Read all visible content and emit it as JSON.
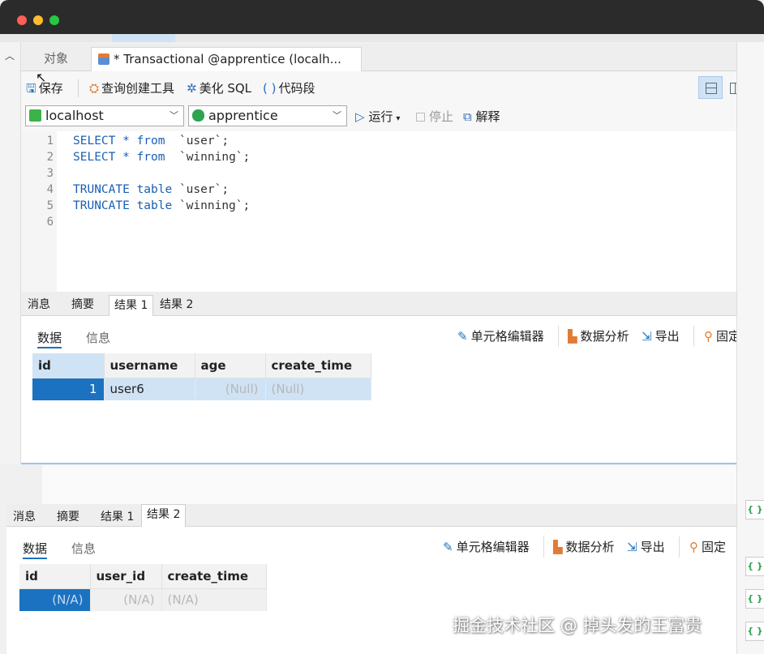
{
  "window": {
    "title_tab_selected": ""
  },
  "tabs": {
    "objects": "对象",
    "query": "* Transactional @apprentice (localh..."
  },
  "toolbar": {
    "save": "保存",
    "query_builder": "查询创建工具",
    "beautify": "美化 SQL",
    "snippet": "代码段"
  },
  "connection": {
    "host": "localhost",
    "database": "apprentice"
  },
  "run": {
    "run": "运行",
    "stop": "停止",
    "explain": "解释"
  },
  "editor": {
    "line_numbers": [
      "1",
      "2",
      "3",
      "4",
      "5",
      "6"
    ],
    "lines": [
      {
        "kw": "SELECT * from",
        "rest": "  `user`;"
      },
      {
        "kw": "SELECT * from",
        "rest": "  `winning`;"
      },
      {
        "kw": "",
        "rest": ""
      },
      {
        "kw": "TRUNCATE table",
        "rest": " `user`;"
      },
      {
        "kw": "TRUNCATE table",
        "rest": " `winning`;"
      },
      {
        "kw": "",
        "rest": ""
      }
    ]
  },
  "result_tabs": [
    "消息",
    "摘要",
    "结果 1",
    "结果 2"
  ],
  "result_subtabs": {
    "data": "数据",
    "info": "信息"
  },
  "result_tools": {
    "cell_editor": "单元格编辑器",
    "analysis": "数据分析",
    "export": "导出",
    "pin": "固定"
  },
  "result1": {
    "columns": [
      "id",
      "username",
      "age",
      "create_time"
    ],
    "rows": [
      [
        "1",
        "user6",
        "(Null)",
        "(Null)"
      ]
    ]
  },
  "result2": {
    "columns": [
      "id",
      "user_id",
      "create_time"
    ],
    "rows": [
      [
        "(N/A)",
        "(N/A)",
        "(N/A)"
      ]
    ]
  },
  "watermark": "掘金技术社区 @ 掉头发的王富贵",
  "colors": {
    "accent": "#1b72c0",
    "selection": "#cfe3f5"
  }
}
